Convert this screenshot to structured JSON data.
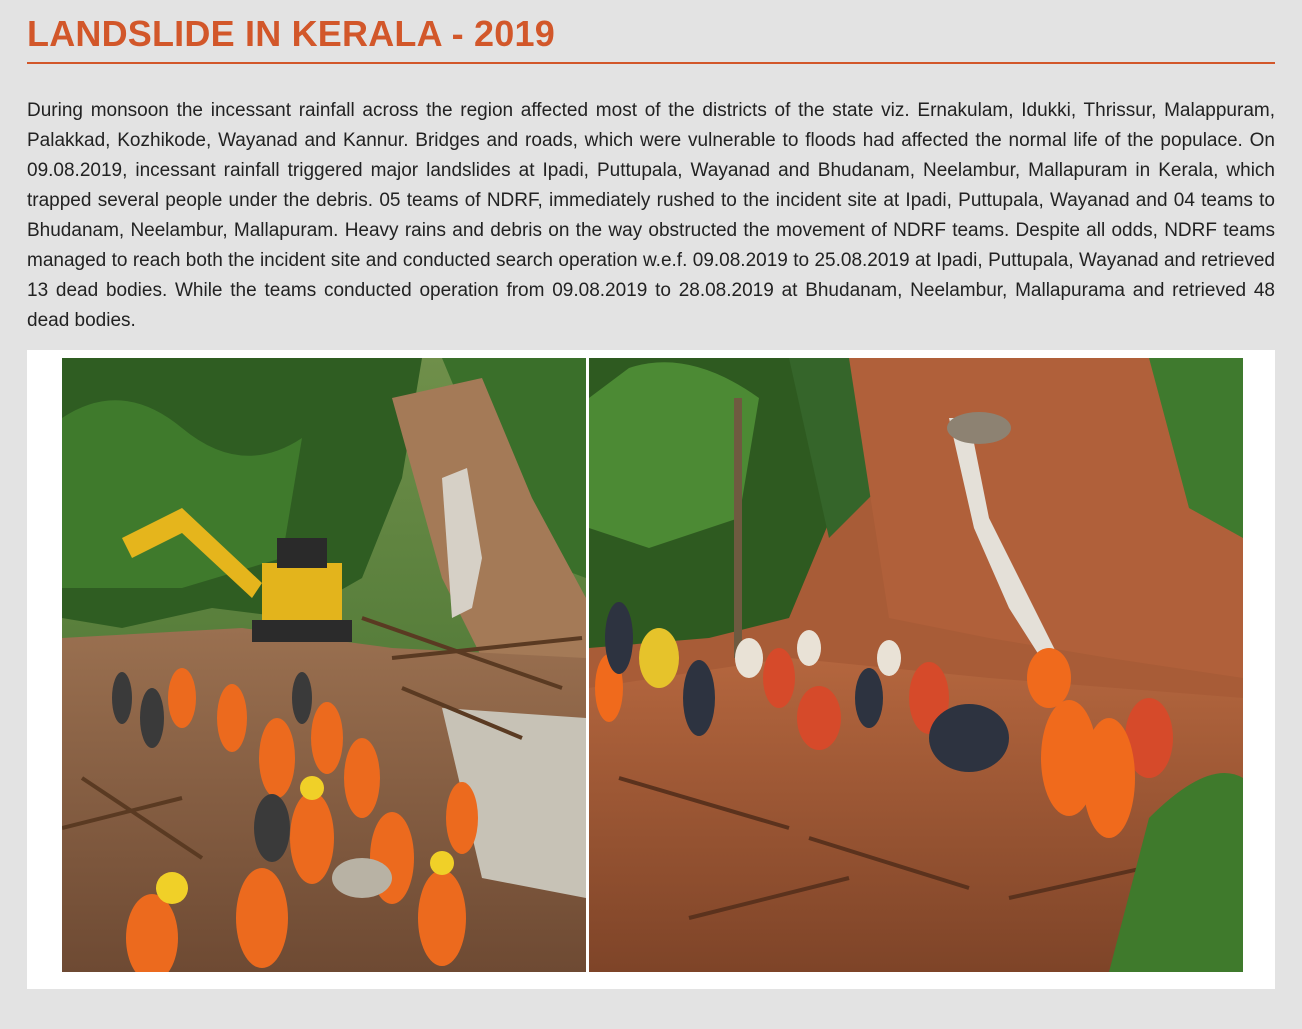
{
  "header": {
    "title": "LANDSLIDE IN KERALA - 2019"
  },
  "article": {
    "paragraph": "During monsoon the incessant rainfall across the region affected most of the districts of the state viz. Ernakulam, Idukki, Thrissur, Malappuram, Palakkad, Kozhikode, Wayanad and Kannur. Bridges and roads, which were vulnerable to floods had affected the normal life of the populace. On 09.08.2019, incessant rainfall triggered major landslides at Ipadi, Puttupala, Wayanad and Bhudanam, Neelambur, Mallapuram in Kerala, which trapped several people under the debris. 05 teams of NDRF, immediately rushed to the incident site at Ipadi, Puttupala, Wayanad and 04 teams to Bhudanam, Neelambur, Mallapuram. Heavy rains and debris on the way obstructed the movement of NDRF teams. Despite all odds, NDRF teams managed to reach both the incident site and conducted search operation w.e.f. 09.08.2019 to 25.08.2019 at Ipadi, Puttupala, Wayanad and retrieved 13 dead bodies. While the teams conducted operation from 09.08.2019 to 28.08.2019 at Bhudanam, Neelambur, Mallapurama and retrieved 48 dead bodies."
  },
  "colors": {
    "accent": "#d2572a",
    "page_background": "#e3e3e3",
    "text": "#222222"
  },
  "photos": [
    {
      "name": "landslide-rescue-photo-left",
      "subject": "excavator and rescue workers in orange in muddy landslide area"
    },
    {
      "name": "landslide-rescue-photo-right",
      "subject": "rescue teams crossing reddish landslide debris below a hill"
    }
  ]
}
